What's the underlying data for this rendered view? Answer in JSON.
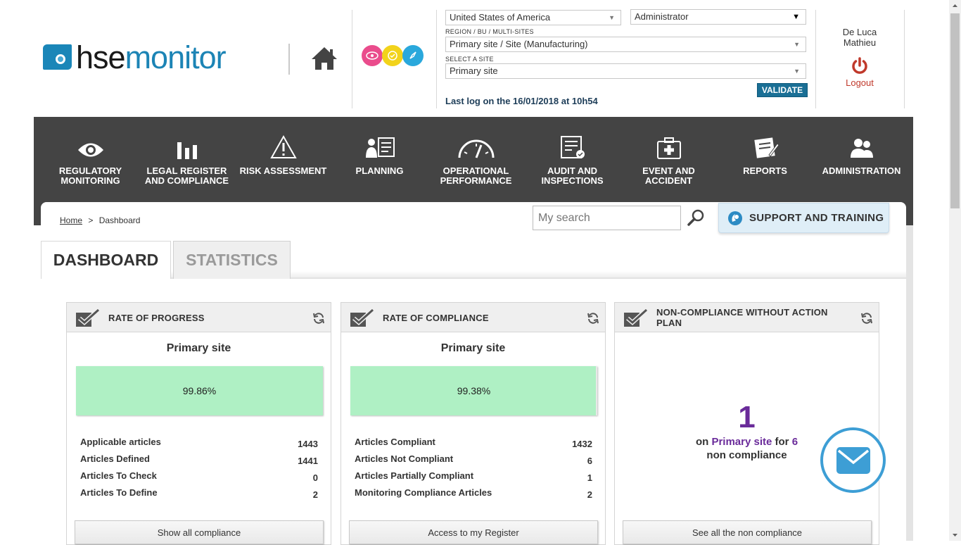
{
  "header": {
    "logo_hse": "hse",
    "logo_monitor": "monitor",
    "country_select": "United States of America",
    "role_select": "Administrator",
    "region_label": "REGION / BU / MULTI-SITES",
    "region_select": "Primary site / Site (Manufacturing)",
    "site_label": "SELECT A SITE",
    "site_select": "Primary site",
    "validate_label": "VALIDATE",
    "last_log": "Last log on the 16/01/2018 at 10h54",
    "user_first": "De Luca",
    "user_last": "Mathieu",
    "logout_label": "Logout"
  },
  "nav": {
    "items": [
      {
        "label": "REGULATORY MONITORING",
        "icon": "eye-icon"
      },
      {
        "label": "LEGAL REGISTER AND COMPLIANCE",
        "icon": "bar-chart-icon"
      },
      {
        "label": "RISK ASSESSMENT",
        "icon": "warning-icon"
      },
      {
        "label": "PLANNING",
        "icon": "planning-icon"
      },
      {
        "label": "OPERATIONAL PERFORMANCE",
        "icon": "gauge-icon"
      },
      {
        "label": "AUDIT AND INSPECTIONS",
        "icon": "checklist-icon"
      },
      {
        "label": "EVENT AND ACCIDENT",
        "icon": "first-aid-icon"
      },
      {
        "label": "REPORTS",
        "icon": "reports-icon"
      },
      {
        "label": "ADMINISTRATION",
        "icon": "users-icon"
      }
    ]
  },
  "breadcrumb": {
    "home": "Home",
    "sep": ">",
    "current": "Dashboard"
  },
  "search": {
    "placeholder": "My search"
  },
  "support": {
    "label": "SUPPORT AND TRAINING"
  },
  "tabs": {
    "dashboard": "DASHBOARD",
    "statistics": "STATISTICS"
  },
  "widgets": {
    "progress": {
      "title": "RATE OF PROGRESS",
      "site": "Primary site",
      "percent_label": "99.86%",
      "percent_value": 99.86,
      "stats": [
        {
          "label": "Applicable articles",
          "value": "1443"
        },
        {
          "label": "Articles Defined",
          "value": "1441"
        },
        {
          "label": "Articles To Check",
          "value": "0"
        },
        {
          "label": "Articles To Define",
          "value": "2"
        }
      ],
      "button": "Show all compliance"
    },
    "compliance": {
      "title": "RATE OF COMPLIANCE",
      "site": "Primary site",
      "percent_label": "99.38%",
      "percent_value": 99.38,
      "stats": [
        {
          "label": "Articles Compliant",
          "value": "1432"
        },
        {
          "label": "Articles Not Compliant",
          "value": "6"
        },
        {
          "label": "Articles Partially Compliant",
          "value": "1"
        },
        {
          "label": "Monitoring Compliance Articles",
          "value": "2"
        }
      ],
      "button": "Access to my Register"
    },
    "noncompliance": {
      "title": "NON-COMPLIANCE WITHOUT ACTION PLAN",
      "count": "1",
      "on": "on",
      "site": "Primary site",
      "for": "for",
      "total": "6",
      "suffix": "non compliance",
      "button": "See all the non compliance"
    }
  },
  "colors": {
    "nav_bg": "#444444",
    "accent_blue": "#1c84b5",
    "bar_green": "#aff0c4",
    "purple": "#6a2b9a",
    "logout_red": "#c0392b"
  }
}
